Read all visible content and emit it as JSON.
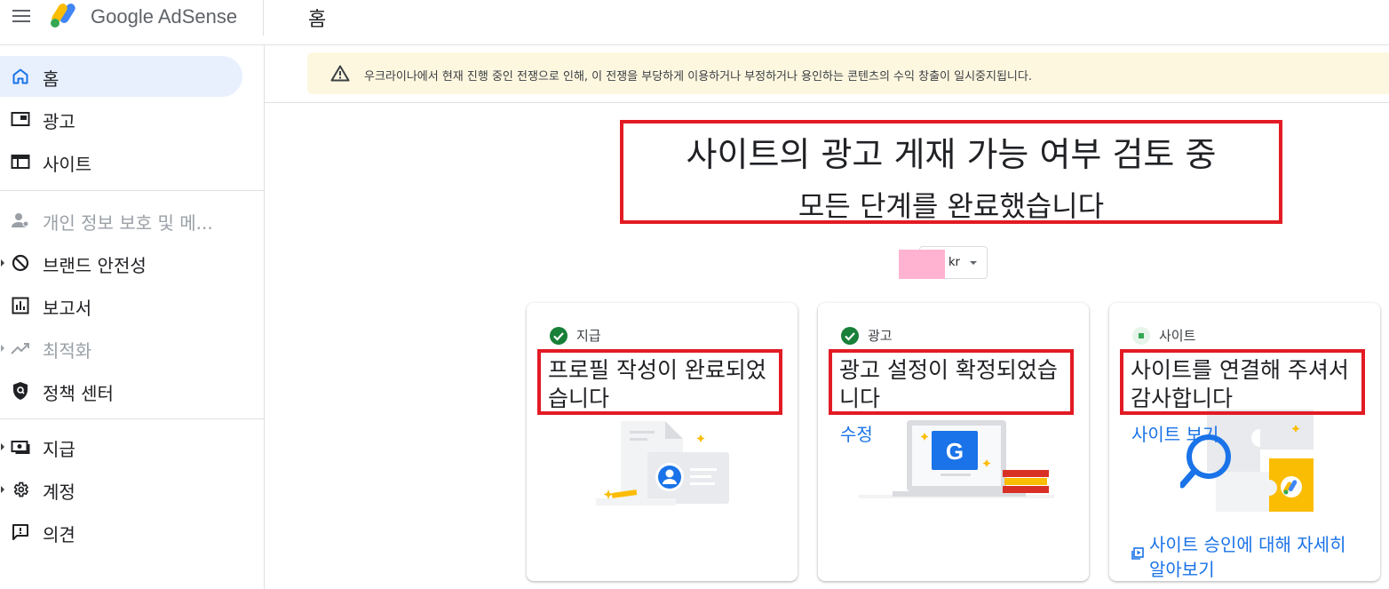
{
  "header": {
    "brand": "Google AdSense",
    "page_title": "홈"
  },
  "sidebar": {
    "items": [
      {
        "label": "홈",
        "icon": "home-icon",
        "active": true
      },
      {
        "label": "광고",
        "icon": "ads-icon"
      },
      {
        "label": "사이트",
        "icon": "sites-icon"
      },
      {
        "label": "개인 정보 보호 및 메...",
        "icon": "privacy-icon",
        "disabled": true
      },
      {
        "label": "브랜드 안전성",
        "icon": "block-icon",
        "expandable": true
      },
      {
        "label": "보고서",
        "icon": "reports-icon"
      },
      {
        "label": "최적화",
        "icon": "trending-icon",
        "disabled": true,
        "expandable": true
      },
      {
        "label": "정책 센터",
        "icon": "shield-icon"
      },
      {
        "label": "지급",
        "icon": "payments-icon",
        "expandable": true
      },
      {
        "label": "계정",
        "icon": "gear-icon",
        "expandable": true
      },
      {
        "label": "의견",
        "icon": "feedback-icon"
      }
    ]
  },
  "banner": {
    "text": "우크라이나에서 현재 진행 중인 전쟁으로 인해, 이 전쟁을 부당하게 이용하거나 부정하거나 용인하는 콘텐츠의 수익 창출이 일시중지됩니다."
  },
  "review": {
    "title": "사이트의 광고 게재 가능 여부 검토 중",
    "subtitle": "모든 단계를 완료했습니다"
  },
  "site_selector": {
    "value": "kr"
  },
  "cards": [
    {
      "step_label": "지급",
      "status": "complete",
      "headline": "프로필 작성이 완료되었습니다",
      "link": ""
    },
    {
      "step_label": "광고",
      "status": "complete",
      "headline": "광고 설정이 확정되었습니다",
      "link": "수정"
    },
    {
      "step_label": "사이트",
      "status": "in-progress",
      "headline": "사이트를 연결해 주셔서 감사합니다",
      "link": "사이트 보기",
      "learn_more": "사이트 승인에 대해 자세히 알아보기"
    }
  ],
  "colors": {
    "accent": "#1a73e8",
    "success": "#188038",
    "highlight_border": "#e21b24",
    "banner_bg": "#fef7e0",
    "active_nav_bg": "#e8f0fe"
  }
}
